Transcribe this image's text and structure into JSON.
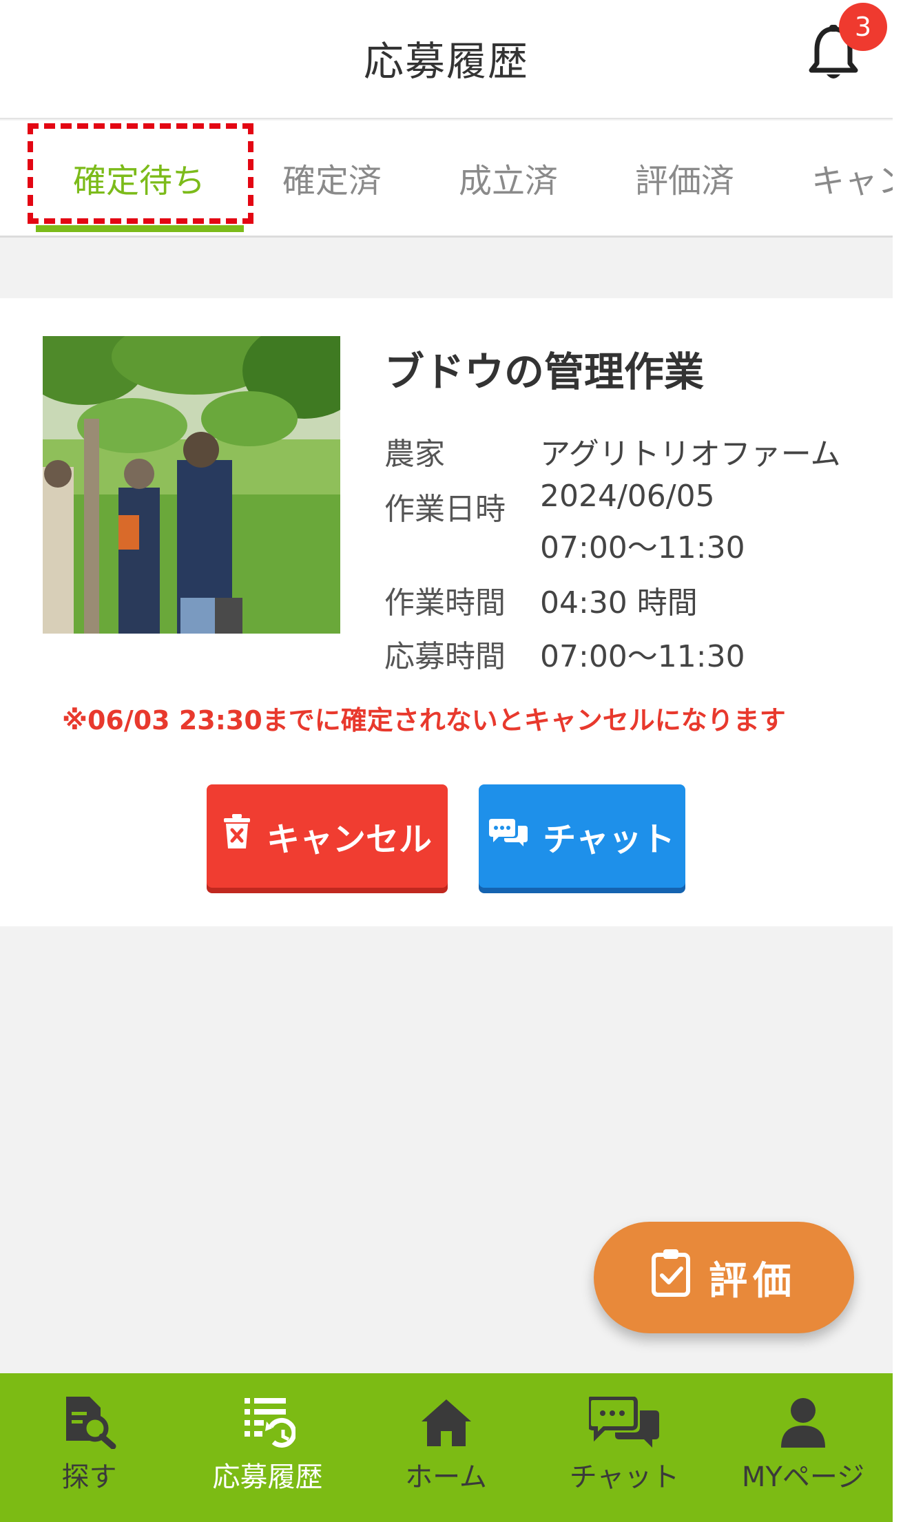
{
  "header": {
    "title": "応募履歴",
    "notification_count": "3",
    "bell_icon": "bell-icon"
  },
  "tabs": [
    {
      "label": "確定待ち",
      "active": true
    },
    {
      "label": "確定済",
      "active": false
    },
    {
      "label": "成立済",
      "active": false
    },
    {
      "label": "評価済",
      "active": false
    },
    {
      "label": "キャンセル",
      "active": false
    }
  ],
  "job": {
    "title": "ブドウの管理作業",
    "photo": "vineyard-workers-photo",
    "rows": [
      {
        "label": "農家",
        "value": "アグリトリオファーム"
      },
      {
        "label": "作業日時",
        "value": "2024/06/05",
        "value2": "07:00〜11:30"
      },
      {
        "label": "作業時間",
        "value": "04:30 時間"
      },
      {
        "label": "応募時間",
        "value": "07:00〜11:30"
      }
    ],
    "warning": "※06/03 23:30までに確定されないとキャンセルになります",
    "cancel_label": "キャンセル",
    "chat_label": "チャット"
  },
  "fab": {
    "label": "評価",
    "icon": "clipboard-check-icon"
  },
  "nav": [
    {
      "label": "探す",
      "icon": "search-doc-icon",
      "active": false
    },
    {
      "label": "応募履歴",
      "icon": "history-list-icon",
      "active": true
    },
    {
      "label": "ホーム",
      "icon": "home-icon",
      "active": false
    },
    {
      "label": "チャット",
      "icon": "chat-bubbles-icon",
      "active": false
    },
    {
      "label": "MYページ",
      "icon": "user-icon",
      "active": false
    }
  ],
  "colors": {
    "accent_green": "#7cbb1a",
    "cancel_red": "#f03d31",
    "chat_blue": "#1e90ea",
    "fab_orange": "#e8893a",
    "warning_red": "#e8392d",
    "highlight_red": "#e30613"
  }
}
